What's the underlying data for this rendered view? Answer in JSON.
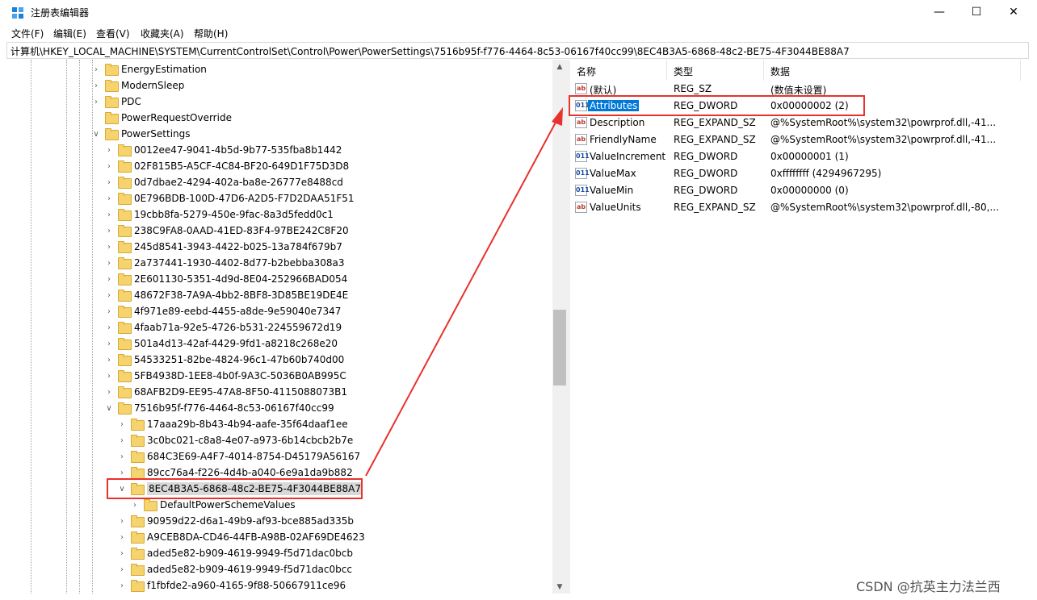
{
  "window": {
    "title": "注册表编辑器",
    "icon": "registry-editor-icon"
  },
  "menu": [
    "文件(F)",
    "编辑(E)",
    "查看(V)",
    "收藏夹(A)",
    "帮助(H)"
  ],
  "address": "计算机\\HKEY_LOCAL_MACHINE\\SYSTEM\\CurrentControlSet\\Control\\Power\\PowerSettings\\7516b95f-f776-4464-8c53-06167f40cc99\\8EC4B3A5-6868-48c2-BE75-4F3044BE88A7",
  "tree": [
    {
      "label": "EnergyEstimation",
      "expander": ">"
    },
    {
      "label": "ModernSleep",
      "expander": ">"
    },
    {
      "label": "PDC",
      "expander": ">"
    },
    {
      "label": "PowerRequestOverride",
      "expander": ""
    },
    {
      "label": "PowerSettings",
      "expander": "v"
    },
    {
      "label": "0012ee47-9041-4b5d-9b77-535fba8b1442",
      "expander": ">"
    },
    {
      "label": "02F815B5-A5CF-4C84-BF20-649D1F75D3D8",
      "expander": ">"
    },
    {
      "label": "0d7dbae2-4294-402a-ba8e-26777e8488cd",
      "expander": ">"
    },
    {
      "label": "0E796BDB-100D-47D6-A2D5-F7D2DAA51F51",
      "expander": ">"
    },
    {
      "label": "19cbb8fa-5279-450e-9fac-8a3d5fedd0c1",
      "expander": ">"
    },
    {
      "label": "238C9FA8-0AAD-41ED-83F4-97BE242C8F20",
      "expander": ">"
    },
    {
      "label": "245d8541-3943-4422-b025-13a784f679b7",
      "expander": ">"
    },
    {
      "label": "2a737441-1930-4402-8d77-b2bebba308a3",
      "expander": ">"
    },
    {
      "label": "2E601130-5351-4d9d-8E04-252966BAD054",
      "expander": ">"
    },
    {
      "label": "48672F38-7A9A-4bb2-8BF8-3D85BE19DE4E",
      "expander": ">"
    },
    {
      "label": "4f971e89-eebd-4455-a8de-9e59040e7347",
      "expander": ">"
    },
    {
      "label": "4faab71a-92e5-4726-b531-224559672d19",
      "expander": ">"
    },
    {
      "label": "501a4d13-42af-4429-9fd1-a8218c268e20",
      "expander": ">"
    },
    {
      "label": "54533251-82be-4824-96c1-47b60b740d00",
      "expander": ">"
    },
    {
      "label": "5FB4938D-1EE8-4b0f-9A3C-5036B0AB995C",
      "expander": ">"
    },
    {
      "label": "68AFB2D9-EE95-47A8-8F50-4115088073B1",
      "expander": ">"
    },
    {
      "label": "7516b95f-f776-4464-8c53-06167f40cc99",
      "expander": "v"
    },
    {
      "label": "17aaa29b-8b43-4b94-aafe-35f64daaf1ee",
      "expander": ">"
    },
    {
      "label": "3c0bc021-c8a8-4e07-a973-6b14cbcb2b7e",
      "expander": ">"
    },
    {
      "label": "684C3E69-A4F7-4014-8754-D45179A56167",
      "expander": ">"
    },
    {
      "label": "89cc76a4-f226-4d4b-a040-6e9a1da9b882",
      "expander": ">"
    },
    {
      "label": "8EC4B3A5-6868-48c2-BE75-4F3044BE88A7",
      "expander": "v",
      "selected": true
    },
    {
      "label": "DefaultPowerSchemeValues",
      "expander": ">"
    },
    {
      "label": "90959d22-d6a1-49b9-af93-bce885ad335b",
      "expander": ">"
    },
    {
      "label": "A9CEB8DA-CD46-44FB-A98B-02AF69DE4623",
      "expander": ">"
    },
    {
      "label": "aded5e82-b909-4619-9949-f5d71dac0bcb",
      "expander": ">"
    },
    {
      "label": "aded5e82-b909-4619-9949-f5d71dac0bcc",
      "expander": ">"
    },
    {
      "label": "f1fbfde2-a960-4165-9f88-50667911ce96",
      "expander": ">"
    }
  ],
  "columns": {
    "name": "名称",
    "type": "类型",
    "data": "数据"
  },
  "values": [
    {
      "name": "(默认)",
      "type": "REG_SZ",
      "data": "(数值未设置)",
      "icon": "string"
    },
    {
      "name": "Attributes",
      "type": "REG_DWORD",
      "data": "0x00000002 (2)",
      "icon": "dword",
      "selected": true
    },
    {
      "name": "Description",
      "type": "REG_EXPAND_SZ",
      "data": "@%SystemRoot%\\system32\\powrprof.dll,-41...",
      "icon": "string"
    },
    {
      "name": "FriendlyName",
      "type": "REG_EXPAND_SZ",
      "data": "@%SystemRoot%\\system32\\powrprof.dll,-41...",
      "icon": "string"
    },
    {
      "name": "ValueIncrement",
      "type": "REG_DWORD",
      "data": "0x00000001 (1)",
      "icon": "dword"
    },
    {
      "name": "ValueMax",
      "type": "REG_DWORD",
      "data": "0xffffffff (4294967295)",
      "icon": "dword"
    },
    {
      "name": "ValueMin",
      "type": "REG_DWORD",
      "data": "0x00000000 (0)",
      "icon": "dword"
    },
    {
      "name": "ValueUnits",
      "type": "REG_EXPAND_SZ",
      "data": "@%SystemRoot%\\system32\\powrprof.dll,-80,...",
      "icon": "string"
    }
  ],
  "watermark": "CSDN @抗英主力法兰西",
  "colors": {
    "accent": "#0078d7",
    "annotation": "#e8322d",
    "folder": "#f5d36e"
  }
}
